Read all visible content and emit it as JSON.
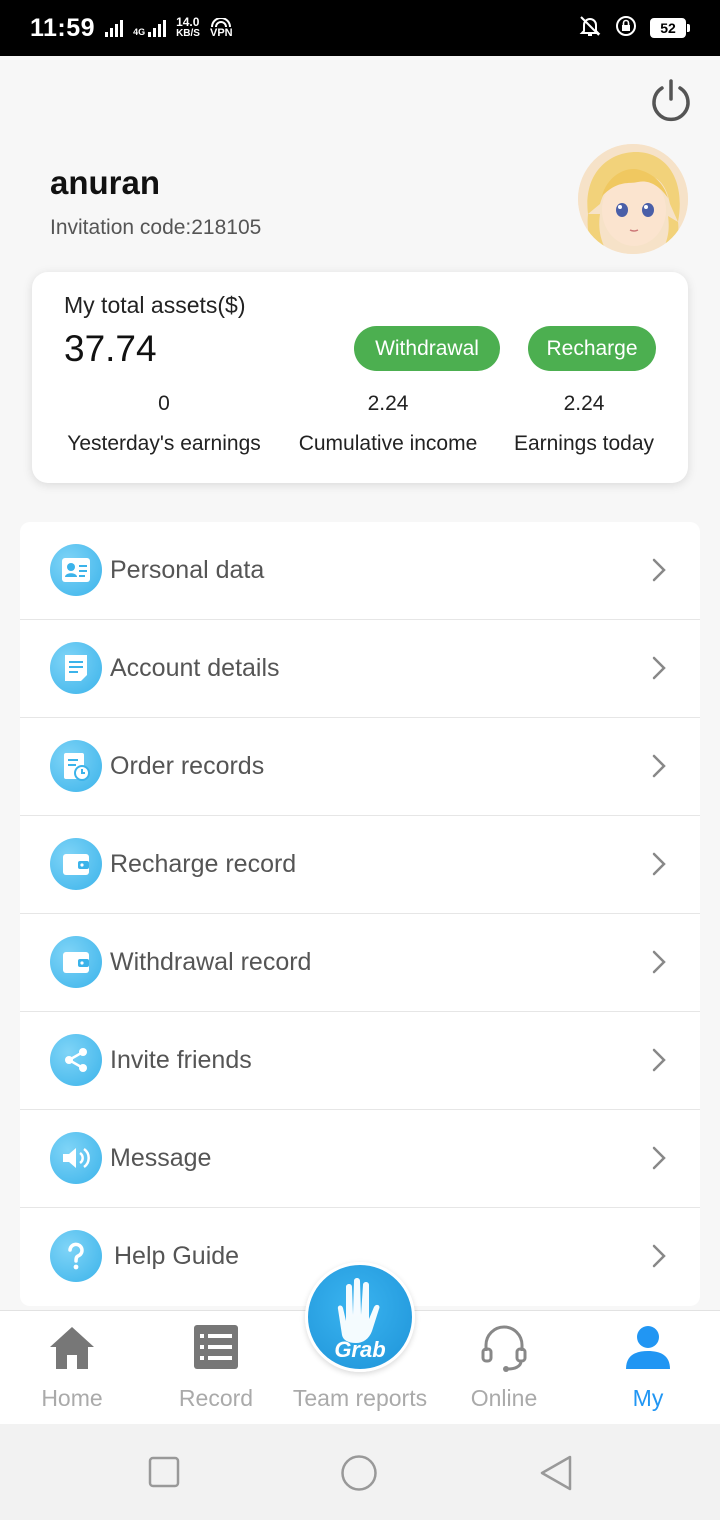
{
  "status_bar": {
    "time": "11:59",
    "network_type": "4G",
    "net_speed_value": "14.0",
    "net_speed_unit": "KB/S",
    "vpn": "VPN",
    "battery": "52"
  },
  "profile": {
    "username": "anuran",
    "invitation_code": "Invitation code:218105"
  },
  "assets": {
    "label": "My total assets($)",
    "total": "37.74",
    "withdraw_label": "Withdrawal",
    "recharge_label": "Recharge",
    "stats": [
      {
        "value": "0",
        "label": "Yesterday's earnings"
      },
      {
        "value": "2.24",
        "label": "Cumulative income"
      },
      {
        "value": "2.24",
        "label": "Earnings today"
      }
    ]
  },
  "menu": {
    "items": [
      {
        "label": "Personal data",
        "icon": "personal-card-icon"
      },
      {
        "label": "Account details",
        "icon": "document-icon"
      },
      {
        "label": "Order records",
        "icon": "order-clock-icon"
      },
      {
        "label": "Recharge record",
        "icon": "wallet-icon"
      },
      {
        "label": "Withdrawal record",
        "icon": "wallet-icon"
      },
      {
        "label": "Invite friends",
        "icon": "share-icon"
      },
      {
        "label": "Message",
        "icon": "speaker-icon"
      },
      {
        "label": "Help Guide",
        "icon": "help-icon"
      }
    ]
  },
  "bottom_nav": {
    "items": [
      {
        "label": "Home",
        "icon": "home-icon"
      },
      {
        "label": "Record",
        "icon": "list-icon"
      },
      {
        "label": "Team reports",
        "icon": "grab-hand-icon"
      },
      {
        "label": "Online",
        "icon": "headset-icon"
      },
      {
        "label": "My",
        "icon": "user-icon"
      }
    ],
    "grab_label": "Grab",
    "active": "My"
  },
  "colors": {
    "accent_green": "#4caf50",
    "accent_blue": "#2196f3",
    "icon_blue": "#3bb3ea",
    "inactive_gray": "#aaaaaa"
  }
}
